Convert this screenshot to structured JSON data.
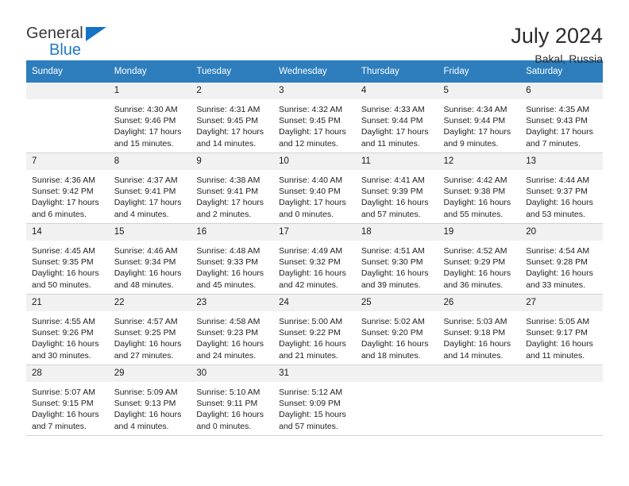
{
  "brand": {
    "name_top": "General",
    "name_bottom": "Blue",
    "accent_color": "#1f7ac8"
  },
  "header": {
    "title": "July 2024",
    "location": "Bakal, Russia",
    "header_bg_color": "#2e7ebd",
    "daynum_bg_color": "#f1f1f1"
  },
  "weekdays": [
    "Sunday",
    "Monday",
    "Tuesday",
    "Wednesday",
    "Thursday",
    "Friday",
    "Saturday"
  ],
  "weeks": [
    [
      {
        "day": "",
        "blank": true,
        "sunrise": "",
        "sunset": "",
        "daylight1": "",
        "daylight2": ""
      },
      {
        "day": "1",
        "sunrise": "Sunrise: 4:30 AM",
        "sunset": "Sunset: 9:46 PM",
        "daylight1": "Daylight: 17 hours",
        "daylight2": "and 15 minutes."
      },
      {
        "day": "2",
        "sunrise": "Sunrise: 4:31 AM",
        "sunset": "Sunset: 9:45 PM",
        "daylight1": "Daylight: 17 hours",
        "daylight2": "and 14 minutes."
      },
      {
        "day": "3",
        "sunrise": "Sunrise: 4:32 AM",
        "sunset": "Sunset: 9:45 PM",
        "daylight1": "Daylight: 17 hours",
        "daylight2": "and 12 minutes."
      },
      {
        "day": "4",
        "sunrise": "Sunrise: 4:33 AM",
        "sunset": "Sunset: 9:44 PM",
        "daylight1": "Daylight: 17 hours",
        "daylight2": "and 11 minutes."
      },
      {
        "day": "5",
        "sunrise": "Sunrise: 4:34 AM",
        "sunset": "Sunset: 9:44 PM",
        "daylight1": "Daylight: 17 hours",
        "daylight2": "and 9 minutes."
      },
      {
        "day": "6",
        "sunrise": "Sunrise: 4:35 AM",
        "sunset": "Sunset: 9:43 PM",
        "daylight1": "Daylight: 17 hours",
        "daylight2": "and 7 minutes."
      }
    ],
    [
      {
        "day": "7",
        "sunrise": "Sunrise: 4:36 AM",
        "sunset": "Sunset: 9:42 PM",
        "daylight1": "Daylight: 17 hours",
        "daylight2": "and 6 minutes."
      },
      {
        "day": "8",
        "sunrise": "Sunrise: 4:37 AM",
        "sunset": "Sunset: 9:41 PM",
        "daylight1": "Daylight: 17 hours",
        "daylight2": "and 4 minutes."
      },
      {
        "day": "9",
        "sunrise": "Sunrise: 4:38 AM",
        "sunset": "Sunset: 9:41 PM",
        "daylight1": "Daylight: 17 hours",
        "daylight2": "and 2 minutes."
      },
      {
        "day": "10",
        "sunrise": "Sunrise: 4:40 AM",
        "sunset": "Sunset: 9:40 PM",
        "daylight1": "Daylight: 17 hours",
        "daylight2": "and 0 minutes."
      },
      {
        "day": "11",
        "sunrise": "Sunrise: 4:41 AM",
        "sunset": "Sunset: 9:39 PM",
        "daylight1": "Daylight: 16 hours",
        "daylight2": "and 57 minutes."
      },
      {
        "day": "12",
        "sunrise": "Sunrise: 4:42 AM",
        "sunset": "Sunset: 9:38 PM",
        "daylight1": "Daylight: 16 hours",
        "daylight2": "and 55 minutes."
      },
      {
        "day": "13",
        "sunrise": "Sunrise: 4:44 AM",
        "sunset": "Sunset: 9:37 PM",
        "daylight1": "Daylight: 16 hours",
        "daylight2": "and 53 minutes."
      }
    ],
    [
      {
        "day": "14",
        "sunrise": "Sunrise: 4:45 AM",
        "sunset": "Sunset: 9:35 PM",
        "daylight1": "Daylight: 16 hours",
        "daylight2": "and 50 minutes."
      },
      {
        "day": "15",
        "sunrise": "Sunrise: 4:46 AM",
        "sunset": "Sunset: 9:34 PM",
        "daylight1": "Daylight: 16 hours",
        "daylight2": "and 48 minutes."
      },
      {
        "day": "16",
        "sunrise": "Sunrise: 4:48 AM",
        "sunset": "Sunset: 9:33 PM",
        "daylight1": "Daylight: 16 hours",
        "daylight2": "and 45 minutes."
      },
      {
        "day": "17",
        "sunrise": "Sunrise: 4:49 AM",
        "sunset": "Sunset: 9:32 PM",
        "daylight1": "Daylight: 16 hours",
        "daylight2": "and 42 minutes."
      },
      {
        "day": "18",
        "sunrise": "Sunrise: 4:51 AM",
        "sunset": "Sunset: 9:30 PM",
        "daylight1": "Daylight: 16 hours",
        "daylight2": "and 39 minutes."
      },
      {
        "day": "19",
        "sunrise": "Sunrise: 4:52 AM",
        "sunset": "Sunset: 9:29 PM",
        "daylight1": "Daylight: 16 hours",
        "daylight2": "and 36 minutes."
      },
      {
        "day": "20",
        "sunrise": "Sunrise: 4:54 AM",
        "sunset": "Sunset: 9:28 PM",
        "daylight1": "Daylight: 16 hours",
        "daylight2": "and 33 minutes."
      }
    ],
    [
      {
        "day": "21",
        "sunrise": "Sunrise: 4:55 AM",
        "sunset": "Sunset: 9:26 PM",
        "daylight1": "Daylight: 16 hours",
        "daylight2": "and 30 minutes."
      },
      {
        "day": "22",
        "sunrise": "Sunrise: 4:57 AM",
        "sunset": "Sunset: 9:25 PM",
        "daylight1": "Daylight: 16 hours",
        "daylight2": "and 27 minutes."
      },
      {
        "day": "23",
        "sunrise": "Sunrise: 4:58 AM",
        "sunset": "Sunset: 9:23 PM",
        "daylight1": "Daylight: 16 hours",
        "daylight2": "and 24 minutes."
      },
      {
        "day": "24",
        "sunrise": "Sunrise: 5:00 AM",
        "sunset": "Sunset: 9:22 PM",
        "daylight1": "Daylight: 16 hours",
        "daylight2": "and 21 minutes."
      },
      {
        "day": "25",
        "sunrise": "Sunrise: 5:02 AM",
        "sunset": "Sunset: 9:20 PM",
        "daylight1": "Daylight: 16 hours",
        "daylight2": "and 18 minutes."
      },
      {
        "day": "26",
        "sunrise": "Sunrise: 5:03 AM",
        "sunset": "Sunset: 9:18 PM",
        "daylight1": "Daylight: 16 hours",
        "daylight2": "and 14 minutes."
      },
      {
        "day": "27",
        "sunrise": "Sunrise: 5:05 AM",
        "sunset": "Sunset: 9:17 PM",
        "daylight1": "Daylight: 16 hours",
        "daylight2": "and 11 minutes."
      }
    ],
    [
      {
        "day": "28",
        "sunrise": "Sunrise: 5:07 AM",
        "sunset": "Sunset: 9:15 PM",
        "daylight1": "Daylight: 16 hours",
        "daylight2": "and 7 minutes."
      },
      {
        "day": "29",
        "sunrise": "Sunrise: 5:09 AM",
        "sunset": "Sunset: 9:13 PM",
        "daylight1": "Daylight: 16 hours",
        "daylight2": "and 4 minutes."
      },
      {
        "day": "30",
        "sunrise": "Sunrise: 5:10 AM",
        "sunset": "Sunset: 9:11 PM",
        "daylight1": "Daylight: 16 hours",
        "daylight2": "and 0 minutes."
      },
      {
        "day": "31",
        "sunrise": "Sunrise: 5:12 AM",
        "sunset": "Sunset: 9:09 PM",
        "daylight1": "Daylight: 15 hours",
        "daylight2": "and 57 minutes."
      },
      {
        "day": "",
        "blank": true,
        "sunrise": "",
        "sunset": "",
        "daylight1": "",
        "daylight2": ""
      },
      {
        "day": "",
        "blank": true,
        "sunrise": "",
        "sunset": "",
        "daylight1": "",
        "daylight2": ""
      },
      {
        "day": "",
        "blank": true,
        "sunrise": "",
        "sunset": "",
        "daylight1": "",
        "daylight2": ""
      }
    ]
  ]
}
